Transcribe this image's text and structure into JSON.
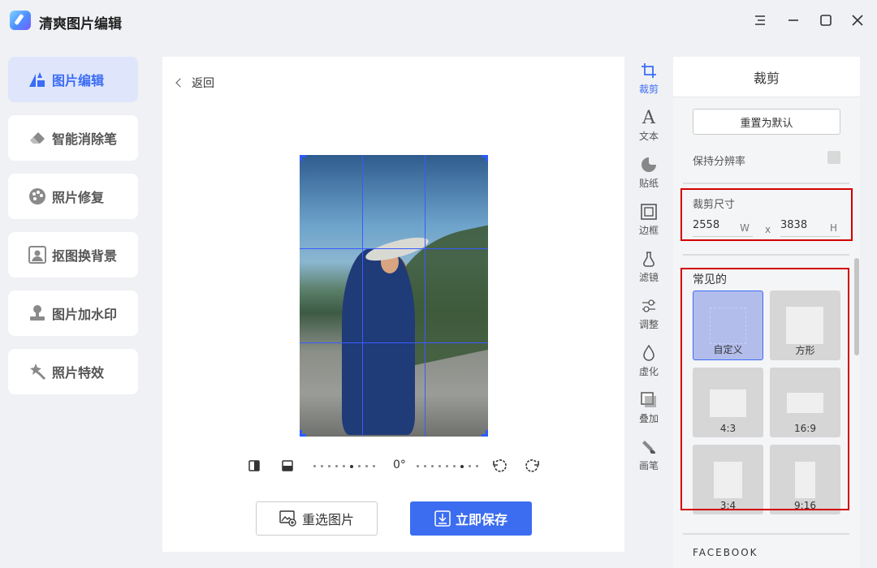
{
  "app": {
    "title": "清爽图片编辑"
  },
  "window_controls": [
    "menu-icon",
    "minimize-icon",
    "maximize-icon",
    "close-icon"
  ],
  "sidebar": {
    "items": [
      {
        "label": "图片编辑",
        "icon": "photo-edit-icon",
        "active": true
      },
      {
        "label": "智能消除笔",
        "icon": "eraser-icon",
        "active": false
      },
      {
        "label": "照片修复",
        "icon": "palette-icon",
        "active": false
      },
      {
        "label": "抠图换背景",
        "icon": "portrait-icon",
        "active": false
      },
      {
        "label": "图片加水印",
        "icon": "stamp-icon",
        "active": false
      },
      {
        "label": "照片特效",
        "icon": "magic-wand-icon",
        "active": false
      }
    ]
  },
  "canvas": {
    "back_label": "返回",
    "rotation_label": "0°",
    "reselect_label": "重选图片",
    "save_label": "立即保存"
  },
  "tool_rail": [
    {
      "label": "裁剪",
      "icon": "crop-icon",
      "active": true
    },
    {
      "label": "文本",
      "icon": "text-icon",
      "active": false
    },
    {
      "label": "贴纸",
      "icon": "sticker-icon",
      "active": false
    },
    {
      "label": "边框",
      "icon": "frame-icon",
      "active": false
    },
    {
      "label": "滤镜",
      "icon": "filter-icon",
      "active": false
    },
    {
      "label": "调整",
      "icon": "adjust-icon",
      "active": false
    },
    {
      "label": "虚化",
      "icon": "blur-icon",
      "active": false
    },
    {
      "label": "叠加",
      "icon": "overlay-icon",
      "active": false
    },
    {
      "label": "画笔",
      "icon": "brush-icon",
      "active": false
    }
  ],
  "crop_panel": {
    "title": "裁剪",
    "reset_label": "重置为默认",
    "keep_resolution_label": "保持分辨率",
    "keep_resolution_checked": false,
    "crop_size_label": "裁剪尺寸",
    "width_value": "2558",
    "width_unit": "W",
    "separator": "x",
    "height_value": "3838",
    "height_unit": "H",
    "common_label": "常见的",
    "presets": [
      {
        "label": "自定义",
        "selected": true
      },
      {
        "label": "方形",
        "selected": false
      },
      {
        "label": "4:3",
        "selected": false
      },
      {
        "label": "16:9",
        "selected": false
      },
      {
        "label": "3:4",
        "selected": false
      },
      {
        "label": "9:16",
        "selected": false
      }
    ],
    "next_section_label": "FACEBOOK"
  },
  "colors": {
    "accent": "#3b6cf6",
    "annotation": "#d40000",
    "save_button": "#3c6df0"
  }
}
